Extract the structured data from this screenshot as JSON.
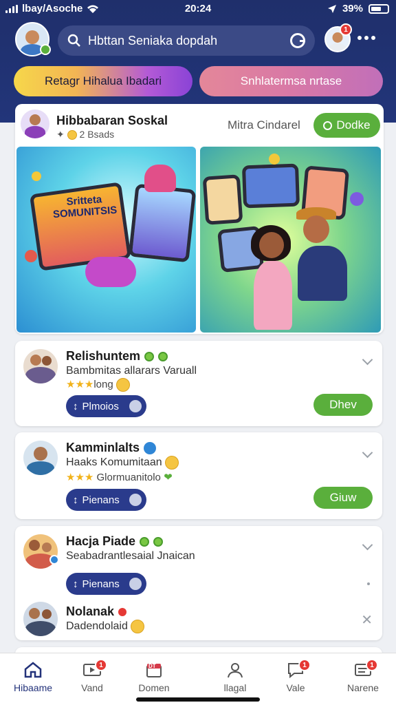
{
  "status_bar": {
    "carrier": "lbay/Asoche",
    "time": "20:24",
    "battery": "39%"
  },
  "header": {
    "search_placeholder": "Hbttan Seniaka dopdah",
    "notif_count": "1"
  },
  "filters": {
    "pill1": "Retagr Hihalua Ibadari",
    "pill2": "Snhlatermsa nrtase"
  },
  "featured": {
    "name": "Hibbabaran Soskal",
    "subtitle": "2 Bsads",
    "middle_label": "Mitra Cindarel",
    "follow_label": "Dodke",
    "screen_text": "Sritteta\nSOMUNITSIS"
  },
  "posts": [
    {
      "title": "Relishuntem",
      "desc": "Bambmitas allarars Varuall",
      "meta": "long",
      "pill": "Plmoios",
      "action": "Dhev"
    },
    {
      "title": "Kamminlalts",
      "desc": "Haaks Komumitaan",
      "meta": "Glormuanitolo",
      "pill": "Pienans",
      "action": "Giuw"
    },
    {
      "title": "Hacja Piade",
      "desc": "Seabadrantlesaial Jnaican",
      "pill": "Pienans"
    },
    {
      "title": "Nolanak",
      "desc": "Dadendolaid"
    }
  ],
  "tabs": [
    {
      "label": "Hibaame",
      "badge": ""
    },
    {
      "label": "Vand",
      "badge": "1"
    },
    {
      "label": "Domen",
      "badge": "DT"
    },
    {
      "label": "llagal",
      "badge": ""
    },
    {
      "label": "Vale",
      "badge": "1"
    },
    {
      "label": "Narene",
      "badge": "1"
    }
  ],
  "colors": {
    "navy": "#22357a",
    "green": "#5aaf3c",
    "pill_blue": "#2a3b8c"
  }
}
